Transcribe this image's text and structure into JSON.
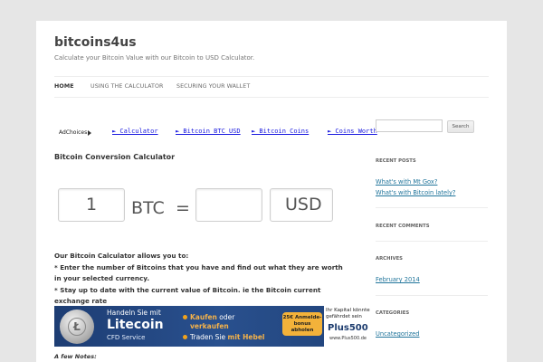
{
  "site": {
    "title": "bitcoins4us",
    "description": "Calculate your Bitcoin Value with our Bitcoin to USD Calculator."
  },
  "nav": {
    "items": [
      {
        "label": "HOME"
      },
      {
        "label": "USING THE CALCULATOR"
      },
      {
        "label": "SECURING YOUR WALLET"
      }
    ]
  },
  "ads": {
    "adchoices": "AdChoices",
    "links": [
      "► Calculator",
      "► Bitcoin BTC USD",
      "► Bitcoin Coins",
      "► Coins Worth"
    ]
  },
  "calculator": {
    "heading": "Bitcoin Conversion Calculator",
    "btc_value": "1",
    "btc_label": "BTC",
    "equals": "=",
    "usd_value": "",
    "usd_label": "USD"
  },
  "intro": {
    "line1": "Our Bitcoin Calculator allows you to:",
    "line2": "* Enter the number of Bitcoins that you have and find out what they are worth in your selected currency.",
    "line3": "* Stay up to date with the current value of Bitcoin. ie the Bitcoin current exchange rate"
  },
  "banner": {
    "line1": "Handeln Sie mit",
    "brand": "Litecoin",
    "sub": "CFD Service",
    "bullet1_a": "Kaufen",
    "bullet1_b": " oder",
    "bullet1_c": "verkaufen",
    "bullet2_a": "Traden Sie ",
    "bullet2_b": "mit Hebel",
    "badge": "25€ Anmelde-bonus abholen",
    "risk": "Ihr Kapital könnte gefährdet sein",
    "logo": "Plus500",
    "url": "www.Plus500.de"
  },
  "notes": {
    "heading": "A few Notes:"
  },
  "sidebar": {
    "search_placeholder": "",
    "search_button": "Search",
    "recent_posts_title": "RECENT POSTS",
    "recent_posts": [
      "What's with Mt Gox?",
      "What's with Bitcoin lately?"
    ],
    "recent_comments_title": "RECENT COMMENTS",
    "archives_title": "ARCHIVES",
    "archives": [
      "February 2014"
    ],
    "categories_title": "CATEGORIES",
    "categories": [
      "Uncategorized"
    ]
  },
  "colors": {
    "background": "#e6e6e6",
    "link": "#21759b",
    "ad_link": "#1a1adf",
    "banner_blue": "#29508e",
    "banner_orange": "#f3b23a"
  }
}
